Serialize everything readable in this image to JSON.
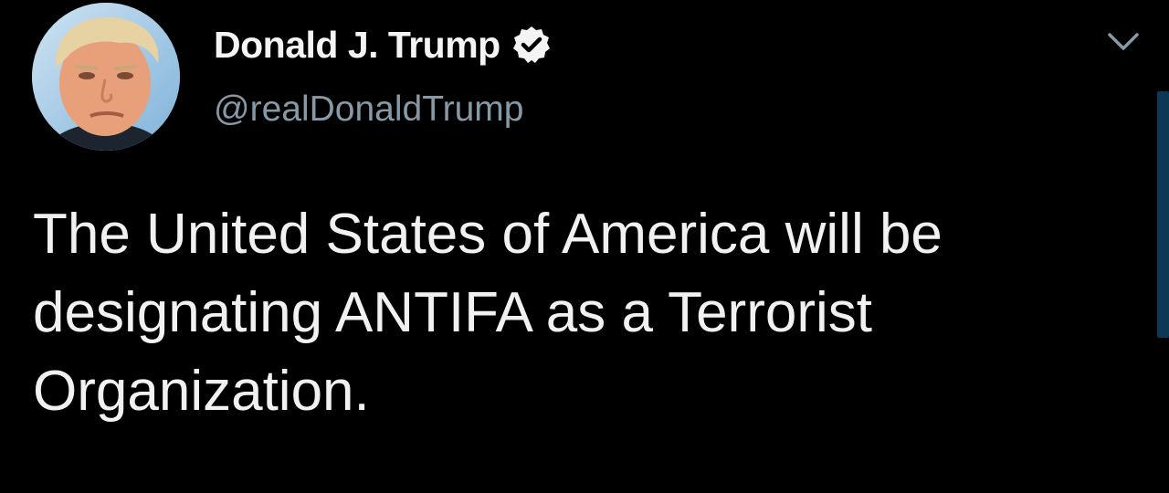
{
  "tweet": {
    "author": {
      "display_name": "Donald J. Trump",
      "handle": "@realDonaldTrump",
      "verified": true
    },
    "text": "The United States of America will be designating ANTIFA as a Terrorist Organization."
  },
  "icons": {
    "verified": "verified-badge-icon",
    "menu": "chevron-down-icon"
  },
  "colors": {
    "background": "#000000",
    "text": "#f1f1f1",
    "handle": "#8899a6",
    "accent": "#1da1f2"
  }
}
